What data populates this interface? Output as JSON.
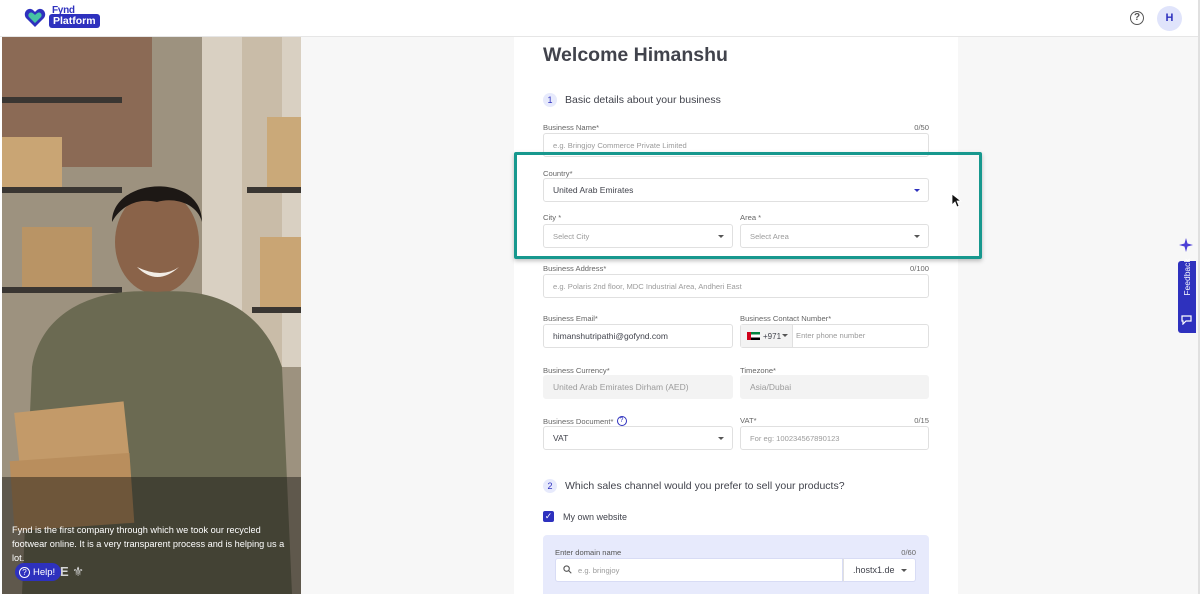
{
  "topbar": {
    "logo_line1": "Fynd",
    "logo_line2": "Platform",
    "help_symbol": "?",
    "avatar_initial": "H"
  },
  "hero": {
    "quote": "Fynd is the first company through which we took our recycled footwear online. It is a very transparent process and is helping us a lot.",
    "brand_marks": "E",
    "help_button": "Help!"
  },
  "form": {
    "title": "Welcome Himanshu",
    "step1": {
      "num": "1",
      "label": "Basic details about your business"
    },
    "business_name": {
      "label": "Business Name*",
      "counter": "0/50",
      "placeholder": "e.g. Bringjoy Commerce Private Limited"
    },
    "country": {
      "label": "Country*",
      "value": "United Arab Emirates"
    },
    "city": {
      "label": "City *",
      "placeholder": "Select City"
    },
    "area": {
      "label": "Area *",
      "placeholder": "Select Area"
    },
    "address": {
      "label": "Business Address*",
      "counter": "0/100",
      "placeholder": "e.g. Polaris 2nd floor, MDC Industrial Area, Andheri East"
    },
    "email": {
      "label": "Business Email*",
      "value": "himanshutripathi@gofynd.com"
    },
    "contact": {
      "label": "Business Contact Number*",
      "code": "+971",
      "placeholder": "Enter phone number"
    },
    "currency": {
      "label": "Business Currency*",
      "value": "United Arab Emirates Dirham (AED)"
    },
    "timezone": {
      "label": "Timezone*",
      "value": "Asia/Dubai"
    },
    "document": {
      "label": "Business Document*",
      "value": "VAT"
    },
    "vat": {
      "label": "VAT*",
      "counter": "0/15",
      "placeholder": "For eg: 100234567890123"
    },
    "step2": {
      "num": "2",
      "label": "Which sales channel would you prefer to sell your products?"
    },
    "own_website": {
      "label": "My own website",
      "checked": true
    },
    "domain": {
      "label": "Enter domain name",
      "counter": "0/60",
      "placeholder": "e.g. bringjoy",
      "suffix": ".hostx1.de"
    }
  },
  "sidebar_widgets": {
    "feedback_label": "Feedback"
  },
  "colors": {
    "accent": "#2e31be",
    "highlight": "#17988e"
  }
}
